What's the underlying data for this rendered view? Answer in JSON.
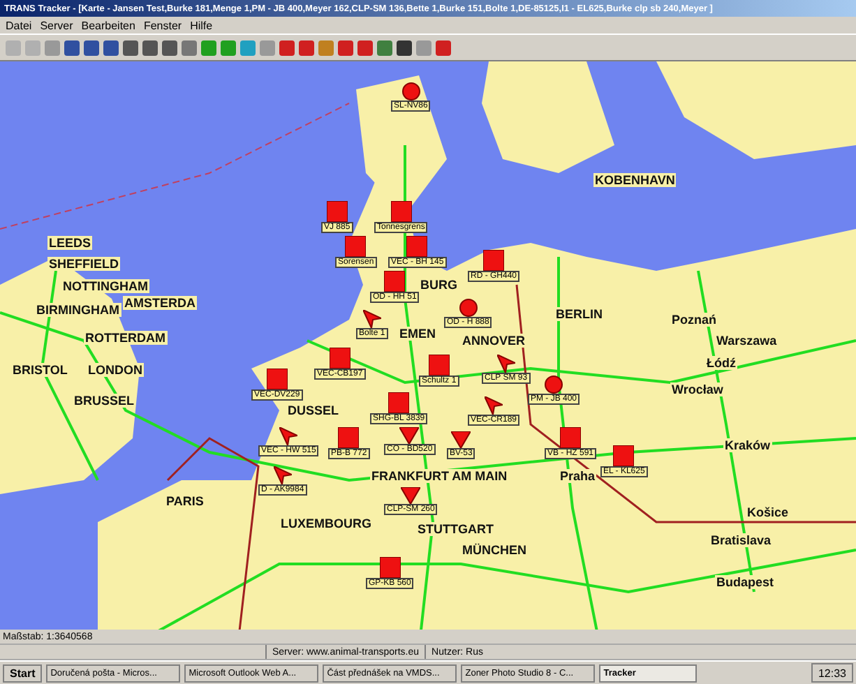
{
  "window": {
    "title": "TRANS Tracker - [Karte - Jansen Test,Burke 181,Menge 1,PM - JB 400,Meyer 162,CLP-SM 136,Bette 1,Burke 151,Bolte 1,DE-85125,I1 - EL625,Burke clp sb 240,Meyer ]"
  },
  "menu": [
    "Datei",
    "Server",
    "Bearbeiten",
    "Fenster",
    "Hilfe"
  ],
  "cities": [
    "LEEDS",
    "SHEFFIELD",
    "NOTTINGHAM",
    "BIRMINGHAM",
    "BRISTOL",
    "LONDON",
    "KOBENHAVN",
    "BURG",
    "EMEN",
    "AMSTERDA",
    "ROTTERDAM",
    "ANNOVER",
    "BERLIN",
    "Poznań",
    "Warszawa",
    "Łódź",
    "Wrocław",
    "DUSSEL",
    "BRUSSEL",
    "FRANKFURT AM MAIN",
    "Praha",
    "Kraków",
    "LUXEMBOURG",
    "PARIS",
    "STUTTGART",
    "MÜNCHEN",
    "Košice",
    "Bratislava",
    "Budapest"
  ],
  "vehicles": [
    {
      "kind": "circle",
      "label": "SL-NV86"
    },
    {
      "kind": "square",
      "label": "VJ 885"
    },
    {
      "kind": "square",
      "label": "Tonnesgrens"
    },
    {
      "kind": "square",
      "label": "Sorensen"
    },
    {
      "kind": "square",
      "label": "VEC - BH 145"
    },
    {
      "kind": "square",
      "label": "OD - HH 51"
    },
    {
      "kind": "square",
      "label": "RD - GH440"
    },
    {
      "kind": "arrow",
      "label": "Bolte 1"
    },
    {
      "kind": "circle",
      "label": "OD - H 888"
    },
    {
      "kind": "square",
      "label": "Schultz 1"
    },
    {
      "kind": "arrow",
      "label": "CLP SM 93"
    },
    {
      "kind": "square",
      "label": "VEC-CB197"
    },
    {
      "kind": "square",
      "label": "SHG-BL 3839"
    },
    {
      "kind": "square",
      "label": "VEC-DV229"
    },
    {
      "kind": "arrow",
      "label": "VEC-CR189"
    },
    {
      "kind": "square",
      "label": "PB-B 772"
    },
    {
      "kind": "triangle",
      "label": "CO - BD520"
    },
    {
      "kind": "triangle",
      "label": "BV-53"
    },
    {
      "kind": "arrow",
      "label": "VEC - HW 515"
    },
    {
      "kind": "arrow",
      "label": "D - AK9984"
    },
    {
      "kind": "triangle",
      "label": "CLP-SM 260"
    },
    {
      "kind": "circle",
      "label": "PM - JB 400"
    },
    {
      "kind": "square",
      "label": "VB - HZ 591"
    },
    {
      "kind": "square",
      "label": "EL - KL625"
    },
    {
      "kind": "square",
      "label": "GP-KB 560"
    }
  ],
  "status": {
    "scale": "Maßstab: 1:3640568",
    "server": "Server: www.animal-transports.eu",
    "user": "Nutzer: Rus"
  },
  "taskbar": {
    "start": "Start",
    "tasks": [
      {
        "label": "Doručená pošta - Micros...",
        "selected": false
      },
      {
        "label": "Microsoft Outlook Web A...",
        "selected": false
      },
      {
        "label": "Část přednášek na VMDS...",
        "selected": false
      },
      {
        "label": "Zoner Photo Studio 8 - C...",
        "selected": false
      },
      {
        "label": "Tracker",
        "selected": true
      }
    ],
    "clock": "12:33"
  }
}
